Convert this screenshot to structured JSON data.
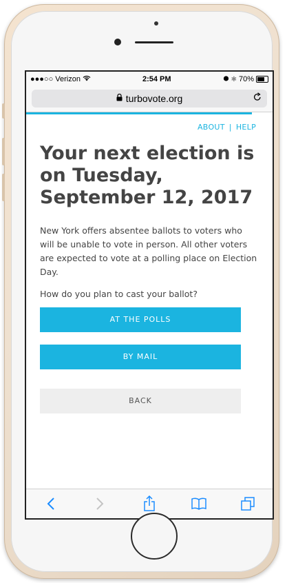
{
  "statusbar": {
    "carrier": "●●●○○ Verizon",
    "time": "2:54 PM",
    "battery": "70%",
    "battery_level": 0.7
  },
  "browser": {
    "url": "turbovote.org"
  },
  "nav": {
    "about": "ABOUT",
    "help": "HELP",
    "separator": "|"
  },
  "page": {
    "headline": "Your next election is on Tuesday, September 12, 2017",
    "description": "New York offers absentee ballots to voters who will be unable to vote in person. All other voters are expected to vote at a polling place on Election Day.",
    "question": "How do you plan to cast your ballot?",
    "buttons": {
      "polls": "AT THE POLLS",
      "mail": "BY MAIL",
      "back": "BACK"
    }
  },
  "colors": {
    "accent": "#1bb4e0",
    "text": "#444444"
  },
  "icons": [
    "wifi-icon",
    "lock-icon",
    "reload-icon",
    "alarm-icon",
    "bluetooth-icon",
    "back-icon",
    "forward-icon",
    "share-icon",
    "bookmarks-icon",
    "tabs-icon"
  ]
}
